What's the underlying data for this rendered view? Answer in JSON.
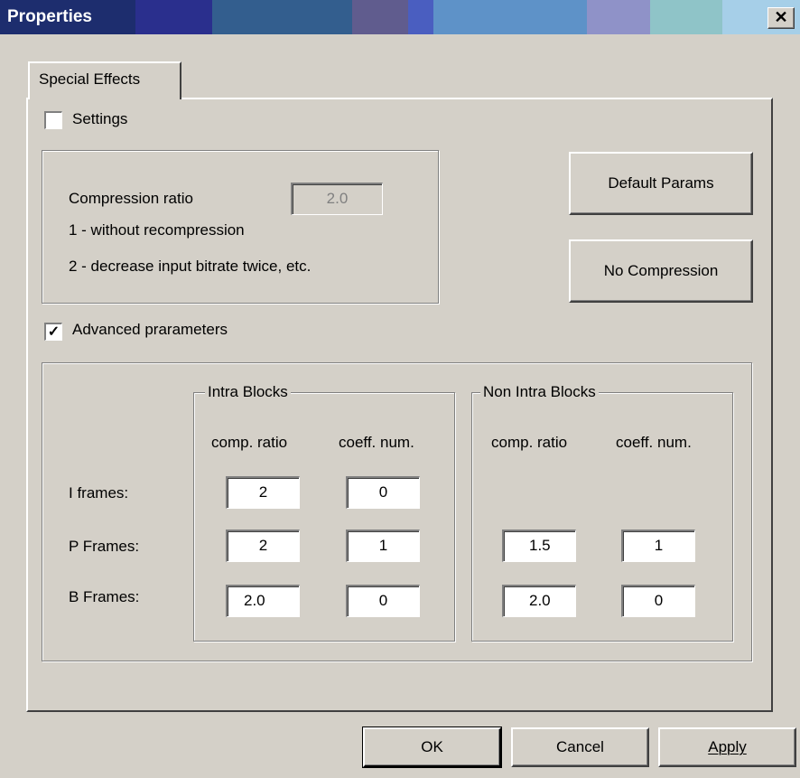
{
  "window": {
    "title": "Properties",
    "close_symbol": "✕"
  },
  "tabs": [
    {
      "label": "Special Effects",
      "active": true
    }
  ],
  "settings": {
    "checkbox_label": "Settings",
    "checked": false
  },
  "compression": {
    "label": "Compression ratio",
    "value": "2.0",
    "hint1": "1 - without recompression",
    "hint2": "2 - decrease input bitrate twice, etc."
  },
  "buttons_side": {
    "default_params": "Default Params",
    "no_compression": "No Compression"
  },
  "advanced": {
    "checkbox_label": "Advanced prarameters",
    "checked": true,
    "check_mark": "✓",
    "intra_group": "Intra Blocks",
    "non_intra_group": "Non Intra Blocks",
    "col_comp_ratio": "comp. ratio",
    "col_coeff_num": "coeff. num.",
    "rows": [
      {
        "label": "I frames:",
        "intra_ratio": "2",
        "intra_coeff": "0",
        "non_ratio": null,
        "non_coeff": null
      },
      {
        "label": "P Frames:",
        "intra_ratio": "2",
        "intra_coeff": "1",
        "non_ratio": "1.5",
        "non_coeff": "1"
      },
      {
        "label": "B Frames:",
        "intra_ratio": "2.0",
        "intra_coeff": "0",
        "non_ratio": "2.0",
        "non_coeff": "0"
      }
    ]
  },
  "footer": {
    "ok": "OK",
    "cancel": "Cancel",
    "apply": "Apply"
  }
}
